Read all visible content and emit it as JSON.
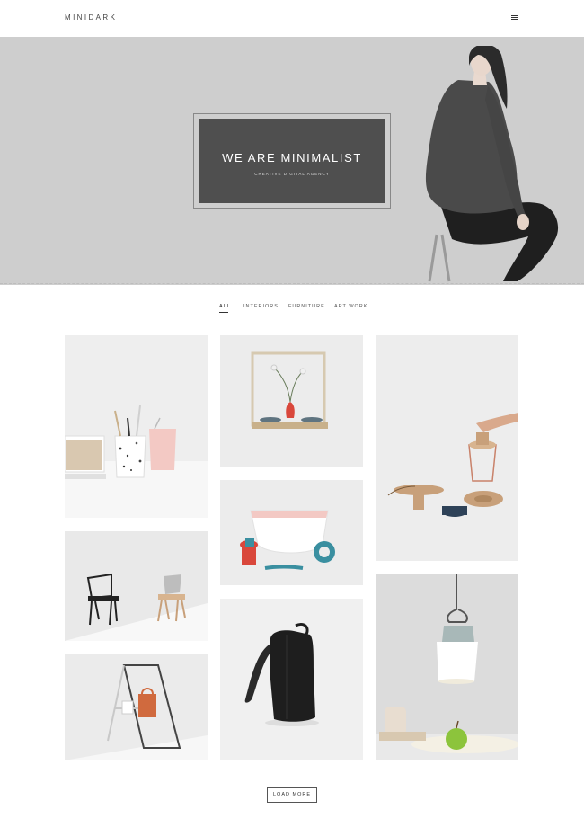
{
  "header": {
    "logo": "MINIDARK",
    "menu_icon": "hamburger-icon"
  },
  "hero": {
    "title": "WE ARE MINIMALIST",
    "subtitle": "CREATIVE DIGITAL AGENCY"
  },
  "filters": {
    "items": [
      {
        "label": "ALL",
        "active": true
      },
      {
        "label": "INTERIORS",
        "active": false
      },
      {
        "label": "FURNITURE",
        "active": false
      },
      {
        "label": "ART WORK",
        "active": false
      }
    ]
  },
  "portfolio": {
    "items": [
      {
        "subject": "desk-organizer-photo"
      },
      {
        "subject": "wall-shelf-vase-photo"
      },
      {
        "subject": "wooden-bowls-lamp-photo"
      },
      {
        "subject": "two-chairs-photo"
      },
      {
        "subject": "kitchen-utensils-bowl-photo"
      },
      {
        "subject": "backpack-photo"
      },
      {
        "subject": "ladder-rack-bag-photo"
      },
      {
        "subject": "pendant-lamp-apple-photo"
      }
    ]
  },
  "load_more": "LOAD MORE",
  "colors": {
    "hero_bg": "#cecece",
    "hero_box": "#4f4f4f",
    "accent_red": "#d9473b",
    "accent_teal": "#3a8fa0"
  }
}
